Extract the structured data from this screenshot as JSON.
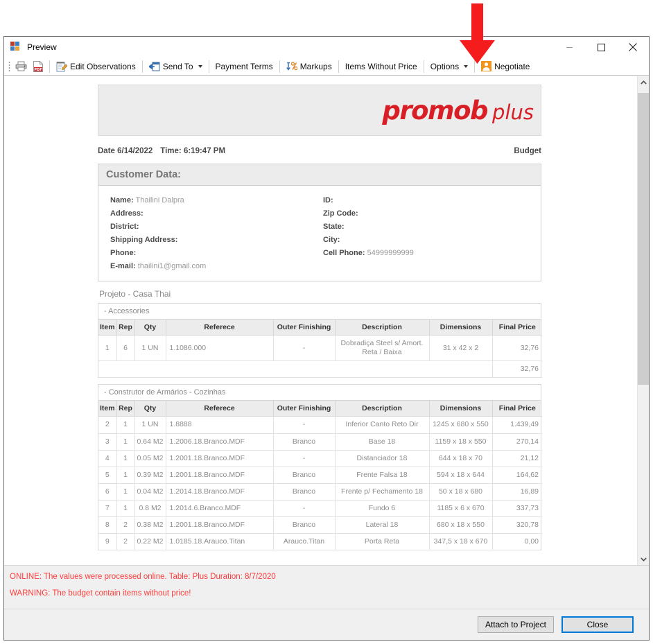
{
  "window": {
    "title": "Preview",
    "icon": "app-window-icon",
    "minimize": "—",
    "maximize": "□",
    "close": "✕"
  },
  "toolbar": {
    "items": [
      {
        "id": "print",
        "label": "",
        "icon": "printer-icon",
        "caret": false
      },
      {
        "id": "export-pdf",
        "label": "",
        "icon": "pdf-icon",
        "caret": false
      },
      {
        "id": "edit-observations",
        "label": "Edit Observations",
        "icon": "edit-note-icon",
        "caret": false
      },
      {
        "id": "send-to",
        "label": "Send To",
        "icon": "send-icon",
        "caret": true
      },
      {
        "id": "payment-terms",
        "label": "Payment Terms",
        "icon": "",
        "caret": false
      },
      {
        "id": "markups",
        "label": "Markups",
        "icon": "markup-percent-icon",
        "caret": false
      },
      {
        "id": "items-without-price",
        "label": "Items Without Price",
        "icon": "",
        "caret": false
      },
      {
        "id": "options",
        "label": "Options",
        "icon": "",
        "caret": true
      },
      {
        "id": "negotiate",
        "label": "Negotiate",
        "icon": "user-person-icon",
        "caret": false
      }
    ]
  },
  "document": {
    "logo": {
      "brand": "promob",
      "suffix": "plus",
      "color": "#d81f26"
    },
    "date_label": "Date 6/14/2022",
    "time_label": "Time: 6:19:47 PM",
    "doc_type": "Budget",
    "customer": {
      "heading": "Customer Data:",
      "rows": [
        {
          "left_label": "Name:",
          "left_value": "Thailini Dalpra",
          "right_label": "ID:",
          "right_value": ""
        },
        {
          "left_label": "Address:",
          "left_value": "",
          "right_label": "Zip Code:",
          "right_value": ""
        },
        {
          "left_label": "District:",
          "left_value": "",
          "right_label": "State:",
          "right_value": ""
        },
        {
          "left_label": "Shipping Address:",
          "left_value": "",
          "right_label": "City:",
          "right_value": ""
        },
        {
          "left_label": "Phone:",
          "left_value": "",
          "right_label": "Cell Phone:",
          "right_value": "54999999999"
        },
        {
          "left_label": "E-mail:",
          "left_value": "thailini1@gmail.com",
          "right_label": "",
          "right_value": ""
        }
      ]
    },
    "project_title": "Projeto - Casa Thai",
    "columns": [
      "Item",
      "Rep",
      "Qty",
      "Referece",
      "Outer Finishing",
      "Description",
      "Dimensions",
      "Final Price"
    ],
    "tables": [
      {
        "group": "- Accessories",
        "rows": [
          {
            "item": "1",
            "rep": "6",
            "qty": "1 UN",
            "ref": "1.1086.000",
            "outer": "-",
            "desc": "Dobradiça Steel s/ Amort. Reta / Baixa",
            "dim": "31 x 42 x 2",
            "price": "32,76"
          }
        ],
        "total": "32,76"
      },
      {
        "group": "- Construtor de Armários - Cozinhas",
        "rows": [
          {
            "item": "2",
            "rep": "1",
            "qty": "1 UN",
            "ref": "1.8888",
            "outer": "-",
            "desc": "Inferior Canto Reto Dir",
            "dim": "1245 x 680 x 550",
            "price": "1.439,49"
          },
          {
            "item": "3",
            "rep": "1",
            "qty": "0.64 M2",
            "ref": "1.2006.18.Branco.MDF",
            "outer": "Branco",
            "desc": "Base 18",
            "dim": "1159 x 18 x 550",
            "price": "270,14"
          },
          {
            "item": "4",
            "rep": "1",
            "qty": "0.05 M2",
            "ref": "1.2001.18.Branco.MDF",
            "outer": "-",
            "desc": "Distanciador 18",
            "dim": "644 x 18 x 70",
            "price": "21,12"
          },
          {
            "item": "5",
            "rep": "1",
            "qty": "0.39 M2",
            "ref": "1.2001.18.Branco.MDF",
            "outer": "Branco",
            "desc": "Frente Falsa 18",
            "dim": "594 x 18 x 644",
            "price": "164,62"
          },
          {
            "item": "6",
            "rep": "1",
            "qty": "0.04 M2",
            "ref": "1.2014.18.Branco.MDF",
            "outer": "Branco",
            "desc": "Frente p/ Fechamento 18",
            "dim": "50 x 18 x 680",
            "price": "16,89"
          },
          {
            "item": "7",
            "rep": "1",
            "qty": "0.8 M2",
            "ref": "1.2014.6.Branco.MDF",
            "outer": "-",
            "desc": "Fundo 6",
            "dim": "1185 x 6 x 670",
            "price": "337,73"
          },
          {
            "item": "8",
            "rep": "2",
            "qty": "0.38 M2",
            "ref": "1.2001.18.Branco.MDF",
            "outer": "Branco",
            "desc": "Lateral 18",
            "dim": "680 x 18 x 550",
            "price": "320,78"
          },
          {
            "item": "9",
            "rep": "2",
            "qty": "0.22 M2",
            "ref": "1.0185.18.Arauco.Titan",
            "outer": "Arauco.Titan",
            "desc": "Porta Reta",
            "dim": "347,5 x 18 x 670",
            "price": "0,00"
          }
        ],
        "total": ""
      }
    ]
  },
  "messages": [
    "ONLINE: The values were processed online. Table: Plus Duration: 8/7/2020",
    "WARNING: The budget contain items without price!"
  ],
  "footer": {
    "attach_label": "Attach to Project",
    "close_label": "Close"
  },
  "annotation": {
    "arrow": "red-down-arrow",
    "color": "#f41c1c",
    "points_at": "Negotiate"
  },
  "scrollbar": {
    "up": "⌃",
    "down": "⌄"
  }
}
